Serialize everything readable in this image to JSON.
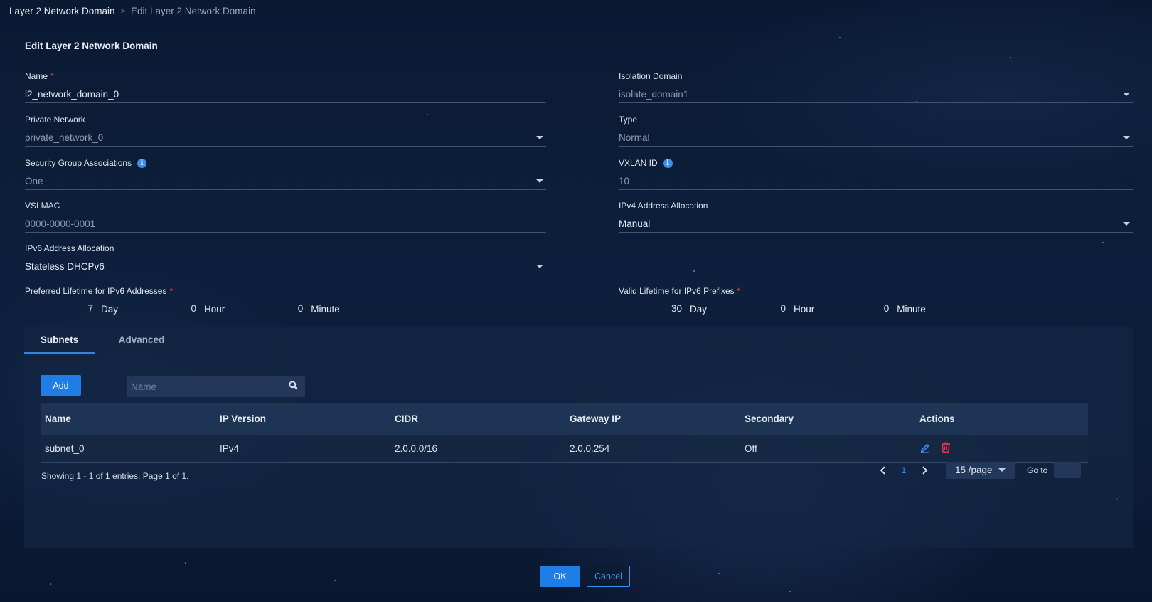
{
  "breadcrumb": {
    "root": "Layer 2 Network Domain",
    "separator": ">",
    "current": "Edit Layer 2 Network Domain"
  },
  "page_title": "Edit Layer 2 Network Domain",
  "form": {
    "name": {
      "label": "Name",
      "required": "*",
      "value": "l2_network_domain_0"
    },
    "isolation_domain": {
      "label": "Isolation Domain",
      "value": "isolate_domain1"
    },
    "private_network": {
      "label": "Private Network",
      "value": "private_network_0"
    },
    "type": {
      "label": "Type",
      "value": "Normal"
    },
    "security_group": {
      "label": "Security Group Associations",
      "value": "One"
    },
    "vxlan_id": {
      "label": "VXLAN ID",
      "value": "10"
    },
    "vsi_mac": {
      "label": "VSI MAC",
      "value": "0000-0000-0001"
    },
    "ipv4_allocation": {
      "label": "IPv4 Address Allocation",
      "value": "Manual"
    },
    "ipv6_allocation": {
      "label": "IPv6 Address Allocation",
      "value": "Stateless DHCPv6"
    },
    "preferred_lifetime": {
      "label": "Preferred Lifetime for IPv6 Addresses",
      "required": "*",
      "day": "7",
      "hour": "0",
      "minute": "0",
      "day_unit": "Day",
      "hour_unit": "Hour",
      "minute_unit": "Minute"
    },
    "valid_lifetime": {
      "label": "Valid Lifetime for IPv6 Prefixes",
      "required": "*",
      "day": "30",
      "hour": "0",
      "minute": "0",
      "day_unit": "Day",
      "hour_unit": "Hour",
      "minute_unit": "Minute"
    }
  },
  "tabs": [
    {
      "label": "Subnets",
      "active": true
    },
    {
      "label": "Advanced",
      "active": false
    }
  ],
  "subnets": {
    "add_label": "Add",
    "search_placeholder": "Name",
    "columns": [
      "Name",
      "IP Version",
      "CIDR",
      "Gateway IP",
      "Secondary",
      "Actions"
    ],
    "rows": [
      {
        "name": "subnet_0",
        "ip_version": "IPv4",
        "cidr": "2.0.0.0/16",
        "gateway_ip": "2.0.0.254",
        "secondary": "Off"
      }
    ],
    "showing": "Showing 1 - 1 of 1 entries. Page 1 of 1.",
    "page": "1",
    "per_page": "15 /page",
    "goto_label": "Go to"
  },
  "footer": {
    "ok_label": "OK",
    "cancel_label": "Cancel"
  },
  "colors": {
    "accent": "#1f7ee6",
    "danger": "#e8344a",
    "required": "#e04646"
  },
  "icons": [
    "info-icon",
    "chevron-down-icon",
    "search-icon",
    "edit-icon",
    "delete-icon",
    "chevron-left-icon",
    "chevron-right-icon"
  ]
}
